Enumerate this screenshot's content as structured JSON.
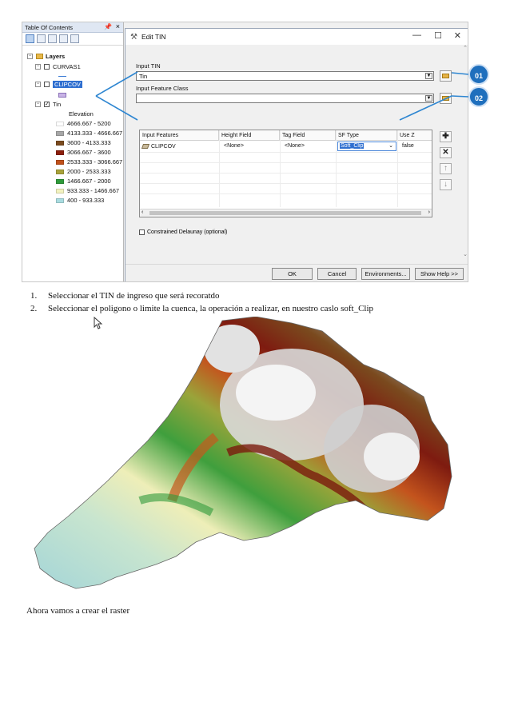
{
  "toc": {
    "title": "Table Of Contents",
    "layers_label": "Layers",
    "curvas": "CURVAS1",
    "clipcov": "CLIPCOV",
    "tin": "Tin",
    "elevation": "Elevation",
    "classes": [
      {
        "label": "4666.667 - 5200",
        "color": "#ffffff"
      },
      {
        "label": "4133.333 - 4666.667",
        "color": "#a6a6a6"
      },
      {
        "label": "3600 - 4133.333",
        "color": "#7a4a1e"
      },
      {
        "label": "3066.667 - 3600",
        "color": "#8b1f0c"
      },
      {
        "label": "2533.333 - 3066.667",
        "color": "#c0501a"
      },
      {
        "label": "2000 - 2533.333",
        "color": "#a8a23a"
      },
      {
        "label": "1466.667 - 2000",
        "color": "#2f9a3a"
      },
      {
        "label": "933.333 - 1466.667",
        "color": "#f2f2bf"
      },
      {
        "label": "400 - 933.333",
        "color": "#a9dce0"
      }
    ]
  },
  "dialog": {
    "title": "Edit TIN",
    "input_tin_label": "Input TIN",
    "input_tin_value": "Tin",
    "input_fc_label": "Input Feature Class",
    "columns": [
      "Input Features",
      "Height Field",
      "Tag Field",
      "SF Type",
      "Use Z"
    ],
    "row": {
      "feature": "CLIPCOV",
      "height": "<None>",
      "tag": "<None>",
      "sf_type": "Soft_Clip",
      "use_z": "false"
    },
    "constrained": "Constrained Delaunay (optional)",
    "buttons": {
      "ok": "OK",
      "cancel": "Cancel",
      "environments": "Environments...",
      "help": "Show Help >>"
    }
  },
  "callouts": {
    "one": "01",
    "two": "02"
  },
  "steps": [
    {
      "n": "1.",
      "text": "Seleccionar el TIN de ingreso que será recoratdo"
    },
    {
      "n": "2.",
      "text": "Seleccionar el poligono  o limite  la cuenca, la operación a realizar,  en nuestro caslo soft_Clip"
    }
  ],
  "closing": "Ahora vamos a crear el raster"
}
